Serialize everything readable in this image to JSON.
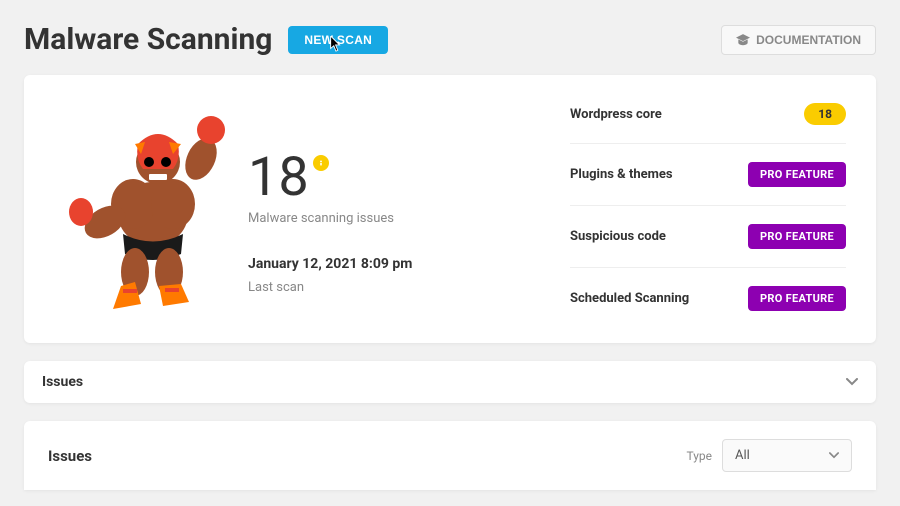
{
  "header": {
    "title": "Malware Scanning",
    "new_scan_label": "NEW SCAN",
    "doc_label": "DOCUMENTATION"
  },
  "summary": {
    "count": "18",
    "count_sub": "Malware scanning issues",
    "last_scan_date": "January 12, 2021 8:09 pm",
    "last_scan_label": "Last scan"
  },
  "categories": [
    {
      "label": "Wordpress core",
      "badge_type": "count",
      "badge_value": "18"
    },
    {
      "label": "Plugins & themes",
      "badge_type": "pro",
      "badge_value": "PRO FEATURE"
    },
    {
      "label": "Suspicious code",
      "badge_type": "pro",
      "badge_value": "PRO FEATURE"
    },
    {
      "label": "Scheduled Scanning",
      "badge_type": "pro",
      "badge_value": "PRO FEATURE"
    }
  ],
  "issues_collapse": {
    "label": "Issues"
  },
  "issues_section": {
    "title": "Issues",
    "type_label": "Type",
    "type_value": "All"
  }
}
